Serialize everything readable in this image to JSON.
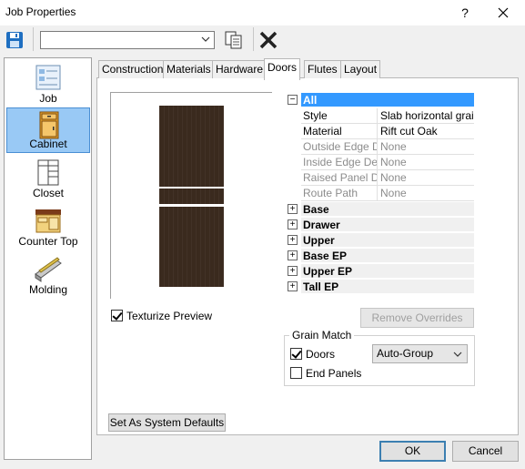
{
  "window": {
    "title": "Job Properties",
    "help_label": "?"
  },
  "toolbar": {
    "combo_value": ""
  },
  "sidebar": {
    "items": [
      {
        "label": "Job",
        "icon": "job-icon"
      },
      {
        "label": "Cabinet",
        "icon": "cabinet-icon",
        "selected": true
      },
      {
        "label": "Closet",
        "icon": "closet-icon"
      },
      {
        "label": "Counter Top",
        "icon": "counter-top-icon"
      },
      {
        "label": "Molding",
        "icon": "molding-icon"
      }
    ]
  },
  "tabs": [
    "Construction",
    "Materials",
    "Hardware",
    "Doors",
    "Flutes",
    "Layout"
  ],
  "active_tab": "Doors",
  "preview": {
    "texturize_label": "Texturize Preview",
    "texturize_checked": true
  },
  "grid": {
    "all_label": "All",
    "properties": [
      {
        "name": "Style",
        "value": "Slab horizontal grain",
        "disabled": false
      },
      {
        "name": "Material",
        "value": "Rift cut Oak",
        "disabled": false
      },
      {
        "name": "Outside Edge Detail",
        "value": "None",
        "disabled": true
      },
      {
        "name": "Inside Edge Detail",
        "value": "None",
        "disabled": true
      },
      {
        "name": "Raised Panel Detail",
        "value": "None",
        "disabled": true
      },
      {
        "name": "Route Path",
        "value": "None",
        "disabled": true
      }
    ],
    "categories": [
      "Base",
      "Drawer",
      "Upper",
      "Base EP",
      "Upper EP",
      "Tall EP"
    ]
  },
  "remove_overrides_label": "Remove Overrides",
  "grain_match": {
    "title": "Grain Match",
    "doors_label": "Doors",
    "doors_checked": true,
    "doors_option": "Auto-Group",
    "end_panels_label": "End Panels",
    "end_panels_checked": false
  },
  "set_defaults_label": "Set As System Defaults",
  "ok_label": "OK",
  "cancel_label": "Cancel",
  "colors": {
    "accent": "#3399ff",
    "selection": "#99c9f5",
    "door_wood": "#3a2a1e"
  }
}
